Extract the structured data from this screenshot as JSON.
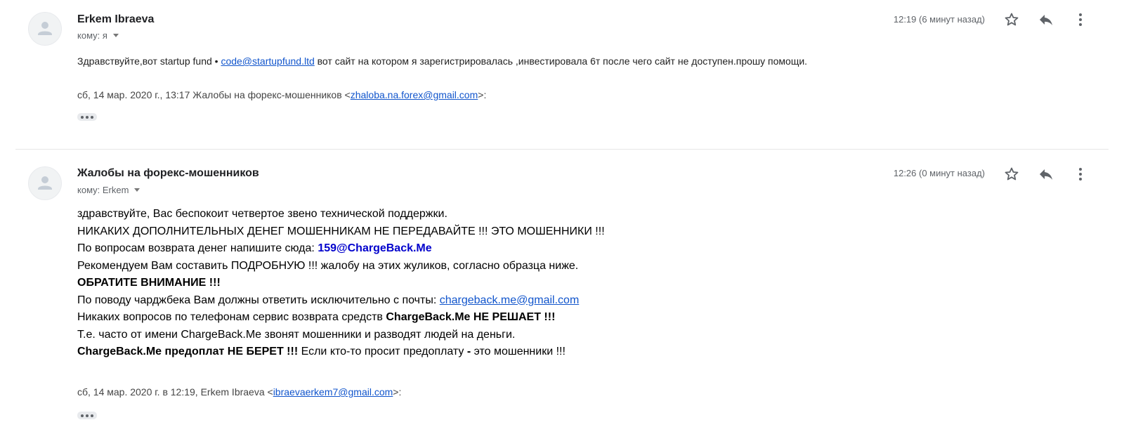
{
  "messages": [
    {
      "sender": "Erkem Ibraeva",
      "to": "кому: я",
      "time": "12:19 (6 минут назад)",
      "body_prefix": "Здравствуйте,вот startup fund • ",
      "body_link": "code@startupfund.ltd",
      "body_suffix": " вот сайт на котором я зарегистрировалась ,инвестировала 6т после чего сайт не доступен.прошу помощи.",
      "quote_prefix": "сб, 14 мар. 2020 г., 13:17 Жалобы на форекс-мошенников <",
      "quote_link": "zhaloba.na.forex@gmail.com",
      "quote_suffix": ">:"
    },
    {
      "sender": "Жалобы на форекс-мошенников",
      "to": "кому: Erkem",
      "time": "12:26 (0 минут назад)",
      "lines": {
        "l1": "здравствуйте, Вас беспокоит четвертое звено технической поддержки.",
        "l2": "НИКАКИХ ДОПОЛНИТЕЛЬНЫХ ДЕНЕГ МОШЕННИКАМ НЕ ПЕРЕДАВАЙТЕ !!! ЭТО МОШЕННИКИ !!!",
        "l3_prefix": "По вопросам возврата денег напишите сюда: ",
        "l3_email": "159@ChargeBack.Me",
        "l4": "Рекомендуем Вам составить ПОДРОБНУЮ !!! жалобу на этих жуликов, согласно образца ниже.",
        "l5": "ОБРАТИТЕ ВНИМАНИЕ !!!",
        "l6_prefix": "По поводу чарджбека Вам должны ответить исключительно с почты: ",
        "l6_link": "chargeback.me@gmail.com",
        "l7_prefix": "Никаких вопросов по телефонам сервис возврата средств ",
        "l7_bold": "ChargeBack.Me НЕ РЕШАЕТ !!!",
        "l8": "Т.е. часто от имени ChargeBack.Me звонят мошенники и разводят людей на деньги.",
        "l9_bold": "ChargeBack.Me предоплат НЕ БЕРЕТ !!!",
        "l9_mid": " Если кто-то просит предоплату ",
        "l9_dash": "-",
        "l9_end": " это мошенники !!!"
      },
      "quote_prefix": "сб, 14 мар. 2020 г. в 12:19, Erkem Ibraeva <",
      "quote_link": "ibraevaerkem7@gmail.com",
      "quote_suffix": ">:"
    }
  ],
  "icons": {
    "avatar": "person-avatar-icon",
    "star": "star-icon",
    "reply": "reply-icon",
    "more": "more-vert-icon",
    "caret": "caret-down-icon",
    "ellipsis": "show-trimmed-content-icon"
  },
  "colors": {
    "link": "#1155cc",
    "email_highlight": "#0000cc",
    "meta_text": "#5f6368"
  }
}
